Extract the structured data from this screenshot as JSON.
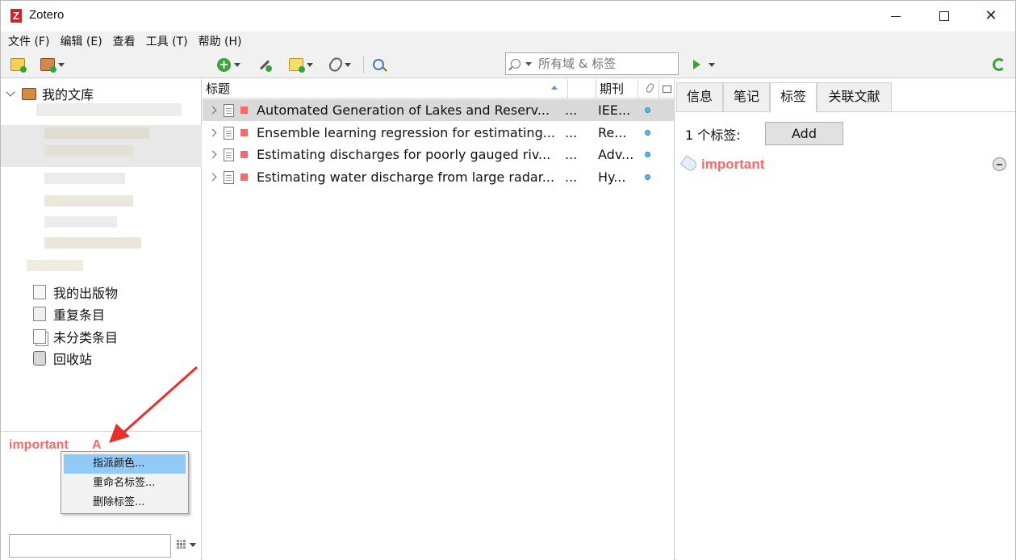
{
  "window": {
    "title": "Zotero",
    "logo_letter": "Z",
    "minimize_glyph": "—",
    "maximize_glyph": "☐",
    "close_glyph": "✕"
  },
  "menubar": {
    "items": [
      "文件 (F)",
      "编辑 (E)",
      "查看",
      "工具 (T)",
      "帮助 (H)"
    ]
  },
  "toolbar": {
    "search_placeholder": "所有域 & 标签",
    "icons": [
      "new-collection-icon",
      "new-library-icon",
      "new-item-icon",
      "add-by-identifier-icon",
      "new-note-icon",
      "attachment-icon",
      "advanced-search-icon",
      "locate-icon",
      "sync-icon"
    ]
  },
  "left_pane": {
    "root_label": "我的文库",
    "items": [
      {
        "label": "我的出版物",
        "icon": "publications-icon"
      },
      {
        "label": "重复条目",
        "icon": "duplicates-icon"
      },
      {
        "label": "未分类条目",
        "icon": "unfiled-icon"
      },
      {
        "label": "回收站",
        "icon": "trash-icon"
      }
    ],
    "tag_selector": {
      "tag": "important",
      "color_letter": "A",
      "tag_color": "#f16b6b",
      "filter_value": ""
    }
  },
  "context_menu": {
    "items": [
      "指派颜色...",
      "重命名标签...",
      "删除标签..."
    ],
    "active_index": 0
  },
  "items_pane": {
    "columns": {
      "title": "标题",
      "publication": "期刊"
    },
    "rows": [
      {
        "title": "Automated Generation of Lakes and Reserv...",
        "dots": "...",
        "publication": "IEE...",
        "selected": true
      },
      {
        "title": "Ensemble learning regression for estimating...",
        "dots": "...",
        "publication": "Re...",
        "selected": false
      },
      {
        "title": "Estimating discharges for poorly gauged riv...",
        "dots": "...",
        "publication": "Adv...",
        "selected": false
      },
      {
        "title": "Estimating water discharge from large radar...",
        "dots": "...",
        "publication": "Hy...",
        "selected": false
      }
    ]
  },
  "right_pane": {
    "tabs": [
      "信息",
      "笔记",
      "标签",
      "关联文献"
    ],
    "active_tab": 2,
    "tag_count_label": "1 个标签:",
    "add_button": "Add",
    "tags": [
      {
        "name": "important",
        "color": "#f16b6b"
      }
    ]
  }
}
